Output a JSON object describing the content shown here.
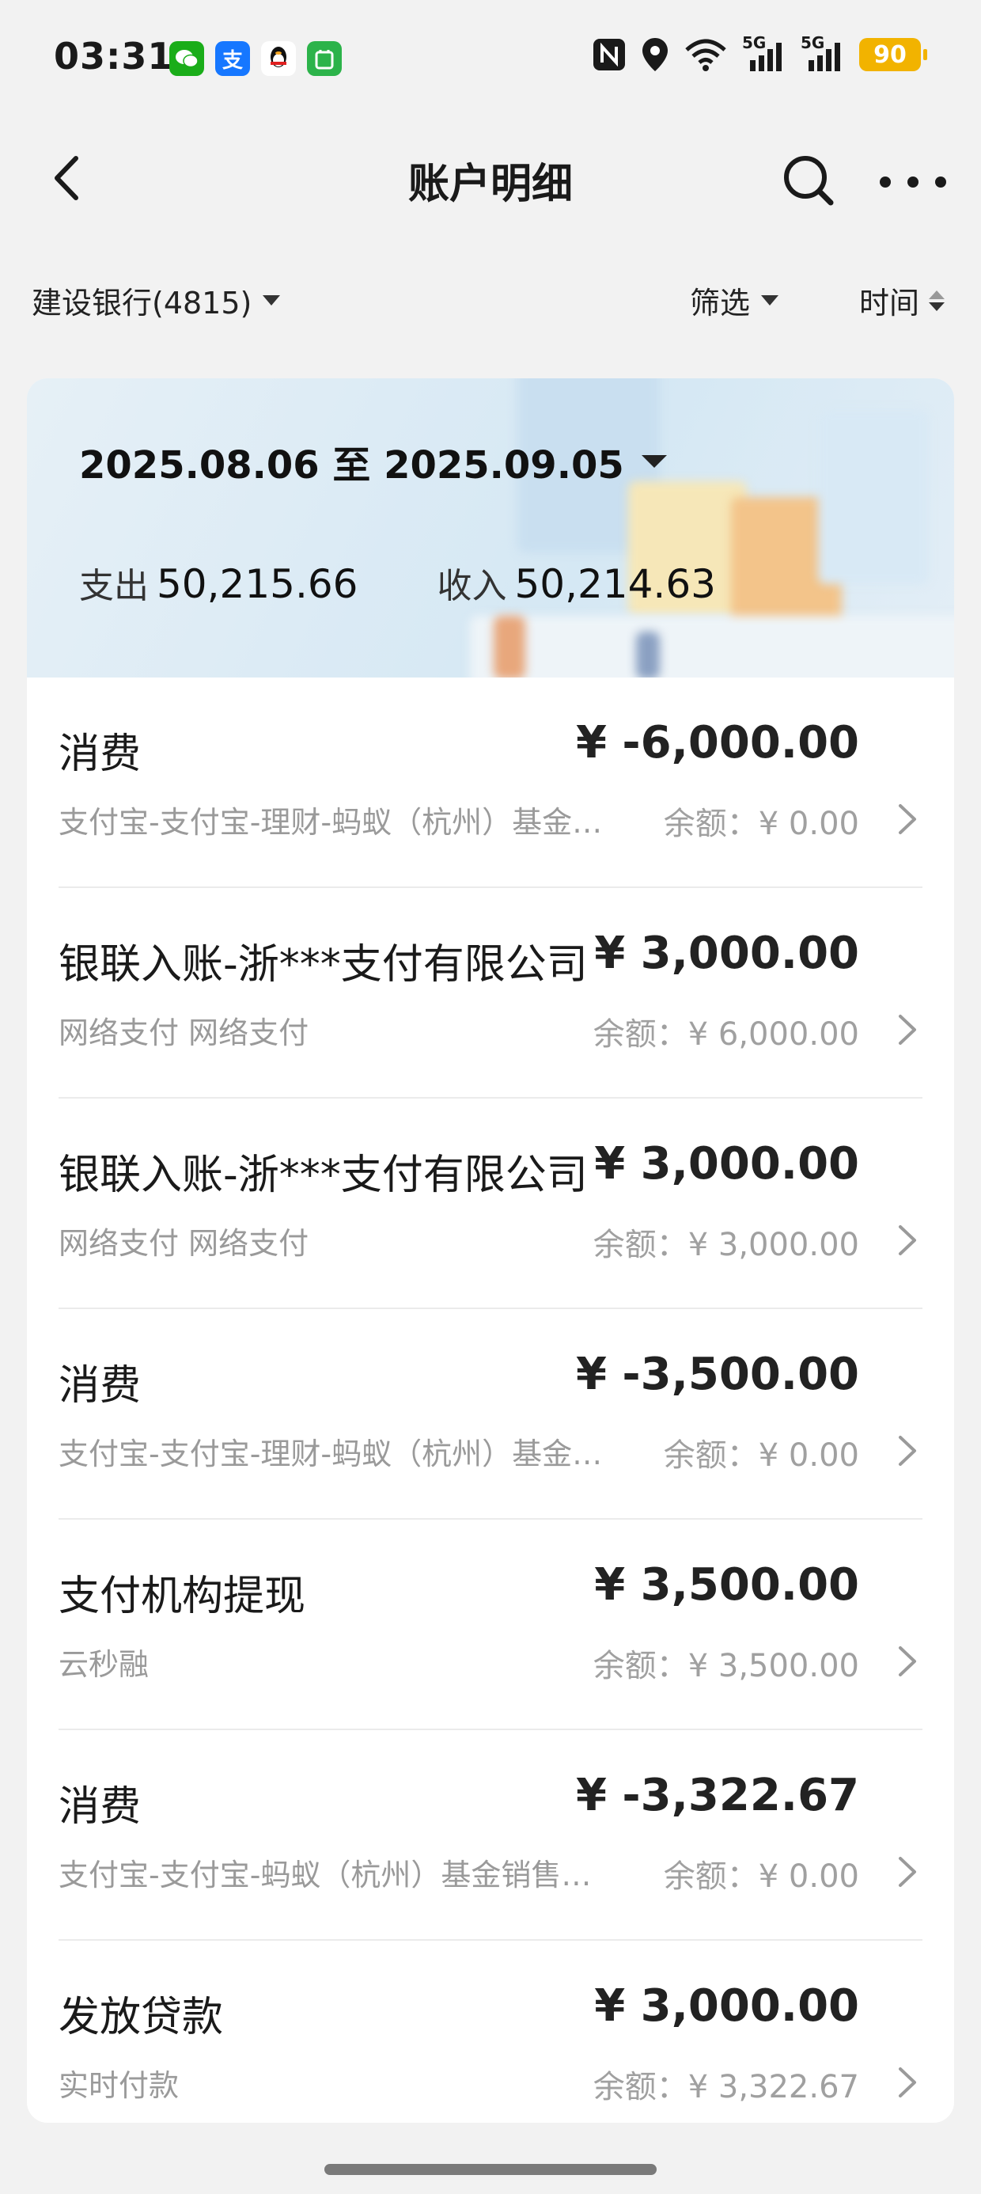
{
  "status_bar": {
    "time": "03:31",
    "apps": [
      {
        "icon": "wechat-icon",
        "glyph": "✉",
        "color": "#1aad19"
      },
      {
        "icon": "alipay-icon",
        "glyph": "支",
        "color": "#1677ff"
      },
      {
        "icon": "qq-icon",
        "glyph": "🐧",
        "color": "#ffffff"
      },
      {
        "icon": "app-store-icon",
        "glyph": "▣",
        "color": "#2cb34a"
      }
    ],
    "network_5g_1": "5G",
    "network_5g_2": "5G",
    "battery": "90"
  },
  "header": {
    "title": "账户明细"
  },
  "filters": {
    "account": "建设银行(4815)",
    "filter_label": "筛选",
    "sort_label": "时间"
  },
  "summary": {
    "date_range": "2025.08.06 至 2025.09.05",
    "expense_label": "支出",
    "expense_value": "50,215.66",
    "income_label": "收入",
    "income_value": "50,214.63"
  },
  "transactions": [
    {
      "title": "消费",
      "amount": "¥ -6,000.00",
      "desc": "支付宝-支付宝-理财-蚂蚁（杭州）基金…",
      "balance": "余额：¥ 0.00"
    },
    {
      "title": "银联入账-浙***支付有限公司",
      "amount": "¥ 3,000.00",
      "desc": "网络支付 网络支付",
      "balance": "余额：¥ 6,000.00"
    },
    {
      "title": "银联入账-浙***支付有限公司",
      "amount": "¥ 3,000.00",
      "desc": "网络支付 网络支付",
      "balance": "余额：¥ 3,000.00"
    },
    {
      "title": "消费",
      "amount": "¥ -3,500.00",
      "desc": "支付宝-支付宝-理财-蚂蚁（杭州）基金…",
      "balance": "余额：¥ 0.00"
    },
    {
      "title": "支付机构提现",
      "amount": "¥ 3,500.00",
      "desc": "云秒融",
      "balance": "余额：¥ 3,500.00"
    },
    {
      "title": "消费",
      "amount": "¥ -3,322.67",
      "desc": "支付宝-支付宝-蚂蚁（杭州）基金销售…",
      "balance": "余额：¥ 0.00"
    },
    {
      "title": "发放贷款",
      "amount": "¥ 3,000.00",
      "desc": "实时付款",
      "balance": "余额：¥ 3,322.67"
    }
  ]
}
